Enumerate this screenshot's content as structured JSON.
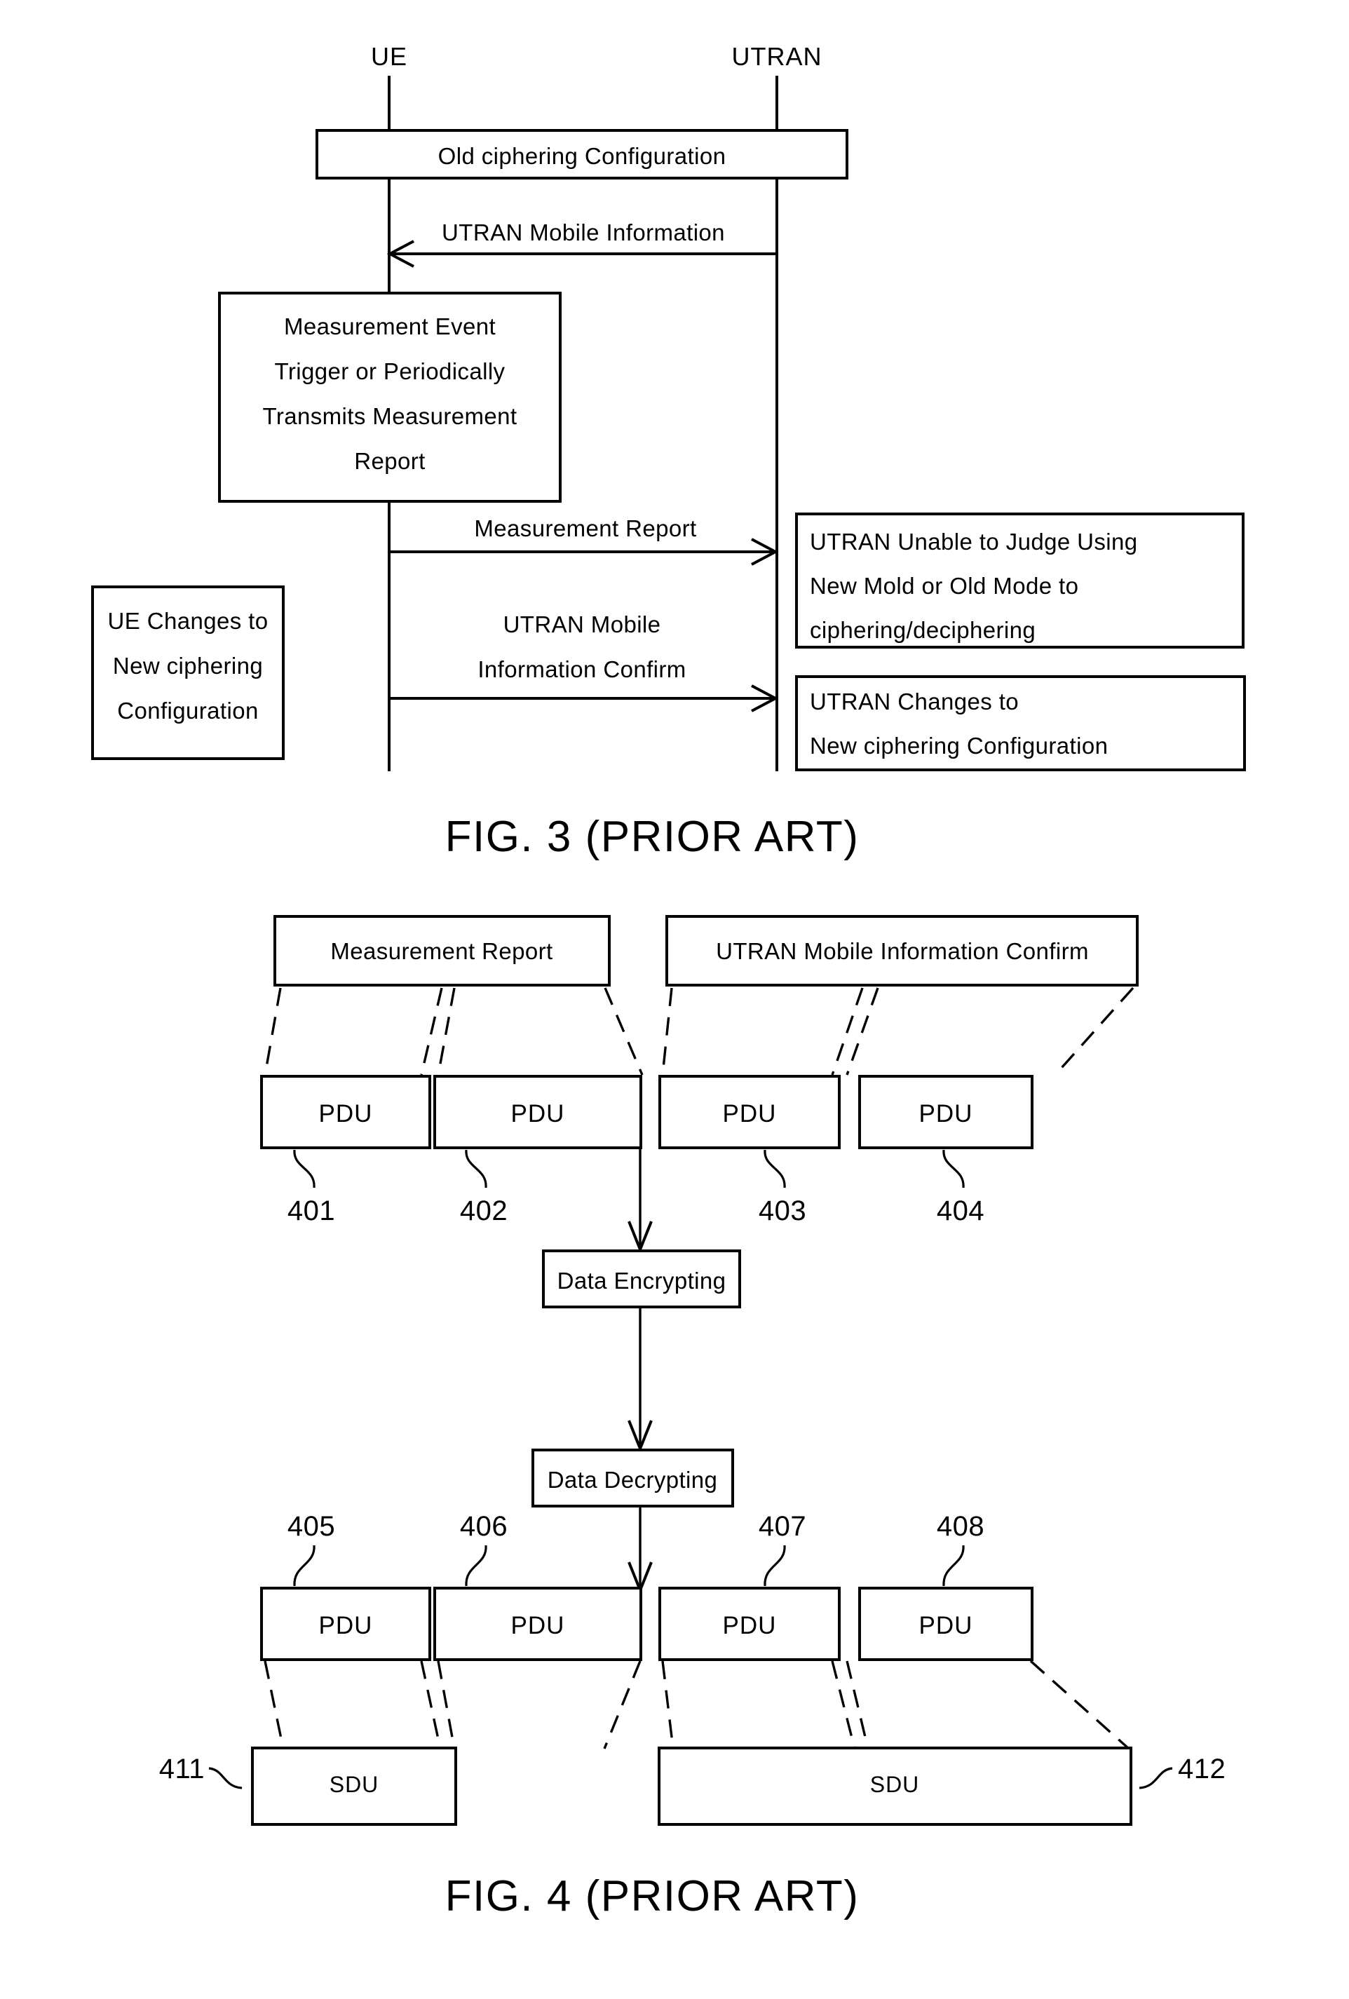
{
  "figure3": {
    "caption": "FIG. 3 (PRIOR ART)",
    "actors": {
      "left": "UE",
      "right": "UTRAN"
    },
    "boxes": {
      "old_ciphering": "Old ciphering Configuration",
      "measurement_event": [
        "Measurement Event",
        "Trigger or Periodically",
        "Transmits Measurement",
        "Report"
      ],
      "ue_changes": [
        "UE Changes to",
        "New ciphering",
        "Configuration"
      ],
      "utran_unable": [
        "UTRAN Unable to Judge Using",
        "New Mold or Old Mode to",
        "ciphering/deciphering"
      ],
      "utran_changes": [
        "UTRAN Changes to",
        "New ciphering Configuration"
      ]
    },
    "messages": {
      "utran_mobile_information": "UTRAN Mobile Information",
      "measurement_report": "Measurement Report",
      "utran_mobile_information_confirm_l1": "UTRAN Mobile",
      "utran_mobile_information_confirm_l2": "Information Confirm"
    }
  },
  "figure4": {
    "caption": "FIG. 4 (PRIOR ART)",
    "source_boxes": {
      "measurement_report": "Measurement Report",
      "utran_mobile_information_confirm": "UTRAN Mobile Information Confirm"
    },
    "pdu_label": "PDU",
    "sdu_label": "SDU",
    "process_boxes": {
      "encrypt": "Data Encrypting",
      "decrypt": "Data Decrypting"
    },
    "refs_top": [
      "401",
      "402",
      "403",
      "404"
    ],
    "refs_bottom": [
      "405",
      "406",
      "407",
      "408"
    ],
    "refs_sdu": [
      "411",
      "412"
    ]
  },
  "colors": {
    "ink": "#000000",
    "paper": "#ffffff"
  }
}
